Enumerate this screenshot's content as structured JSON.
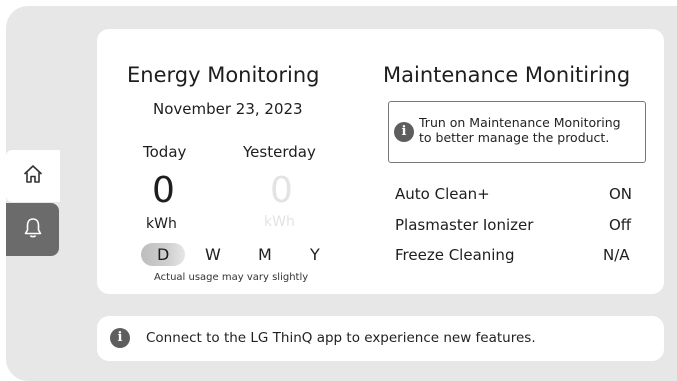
{
  "sidebar": {
    "home_icon": "home-icon",
    "notifications_icon": "bell-icon"
  },
  "energy": {
    "title": "Energy Monitoring",
    "date": "November 23, 2023",
    "today_label": "Today",
    "today_value": "0",
    "today_unit": "kWh",
    "yesterday_label": "Yesterday",
    "yesterday_value": "0",
    "yesterday_unit": "kWh",
    "periods": [
      "D",
      "W",
      "M",
      "Y"
    ],
    "selected_period": "D",
    "note": "Actual usage may vary slightly"
  },
  "maintenance": {
    "title": "Maintenance Monitiring",
    "info_line1": "Trun on Maintenance Monitoring",
    "info_line2": "to better manage the product.",
    "items": [
      {
        "label": "Auto Clean+",
        "value": "ON"
      },
      {
        "label": "Plasmaster Ionizer",
        "value": "Off"
      },
      {
        "label": "Freeze Cleaning",
        "value": "N/A"
      }
    ]
  },
  "banner": {
    "text": "Connect to the LG ThinQ app to experience new features."
  },
  "colors": {
    "frame": "#e7e7e7",
    "card": "#ffffff",
    "selected_tab": "#6b6b6b",
    "info_icon": "#5e5e5e"
  }
}
